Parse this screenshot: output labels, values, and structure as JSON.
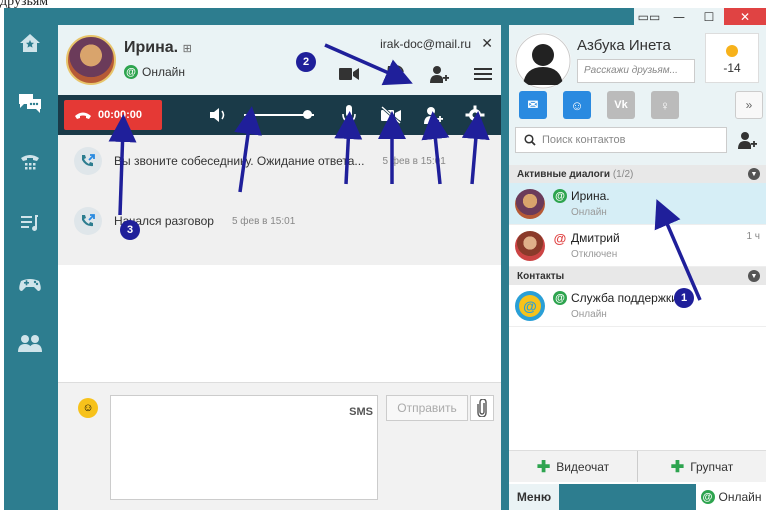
{
  "caption": "друзьям",
  "window": {
    "min": "—",
    "max": "☐",
    "close": "✕",
    "mini": "▭▭"
  },
  "nav": {
    "items": [
      "home",
      "chats",
      "calls",
      "music",
      "games",
      "contacts"
    ]
  },
  "chat": {
    "contact_name": "Ирина.",
    "contact_status": "Онлайн",
    "email": "irak-doc@mail.ru",
    "close": "✕",
    "call_timer": "00:00:00",
    "messages": [
      {
        "text": "Вы звоните собеседнику. Ожидание ответа...",
        "time": "5 фев в 15:01"
      },
      {
        "text": "Начался разговор",
        "time": "5 фев в 15:01"
      }
    ],
    "composer": {
      "sms_label": "SMS",
      "send_label": "Отправить"
    },
    "volume_level": 0.9
  },
  "profile": {
    "name": "Азбука Инета",
    "status_placeholder": "Расскажи друзьям...",
    "temperature": "-14",
    "search_placeholder": "Поиск контактов",
    "more": "»"
  },
  "sections": {
    "active_dialogs": "Активные диалоги",
    "active_count": "(1/2)",
    "contacts": "Контакты"
  },
  "dialogs": [
    {
      "name": "Ирина.",
      "status": "Онлайн",
      "time": "",
      "online": true,
      "active": true
    },
    {
      "name": "Дмитрий",
      "status": "Отключен",
      "time": "1 ч",
      "online": false,
      "active": false
    }
  ],
  "contact_list": [
    {
      "name": "Служба поддержки",
      "status": "Онлайн"
    }
  ],
  "bottom": {
    "video_chat": "Видеочат",
    "group_chat": "Групчат",
    "menu": "Меню",
    "online": "Онлайн"
  },
  "annotations": {
    "badge1": "1",
    "badge2": "2",
    "badge3": "3"
  },
  "colors": {
    "accent": "#2d7d8f",
    "call_red": "#e53935",
    "annotation": "#1f1f9a",
    "online": "#2ea44f"
  }
}
